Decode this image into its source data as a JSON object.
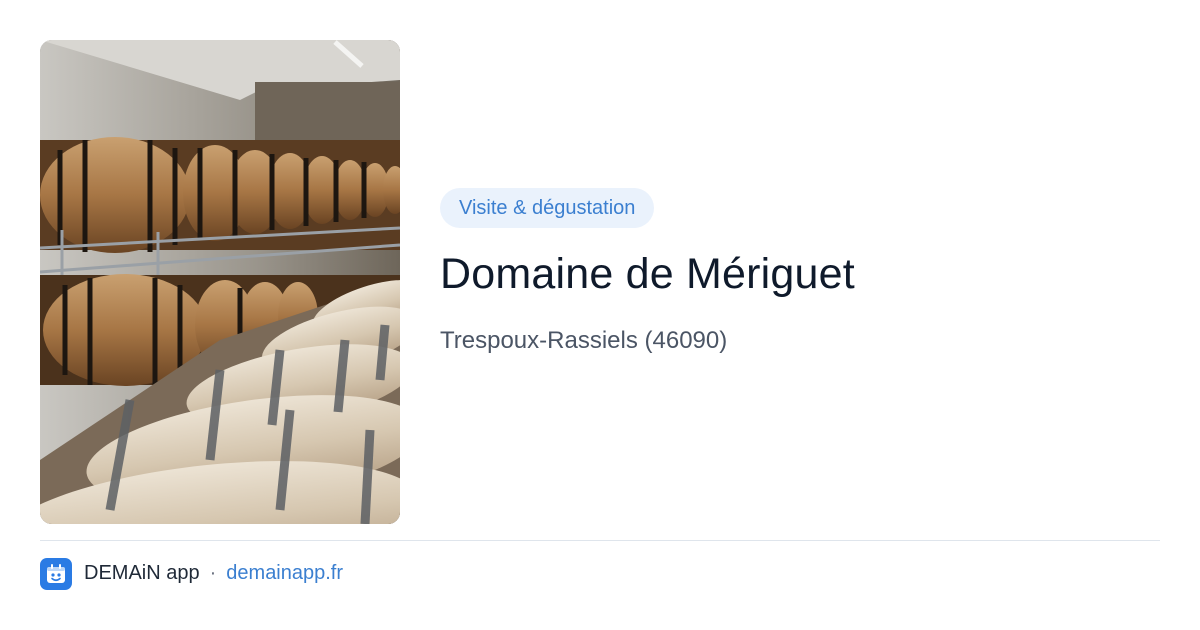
{
  "card": {
    "badge": "Visite & dégustation",
    "title": "Domaine de Mériguet",
    "location": "Trespoux-Rassiels (46090)"
  },
  "footer": {
    "app_name": "DEMAiN app",
    "separator": "·",
    "link": "demainapp.fr"
  },
  "icons": {
    "app_logo": "demain-app-logo-icon",
    "photo": "wine-barrels-cellar-photo"
  },
  "colors": {
    "accent": "#3b7fd0",
    "badge_bg": "#eaf2fc",
    "title": "#0f1a2b",
    "muted": "#4b5565",
    "app_icon_bg": "#2a7be4"
  }
}
